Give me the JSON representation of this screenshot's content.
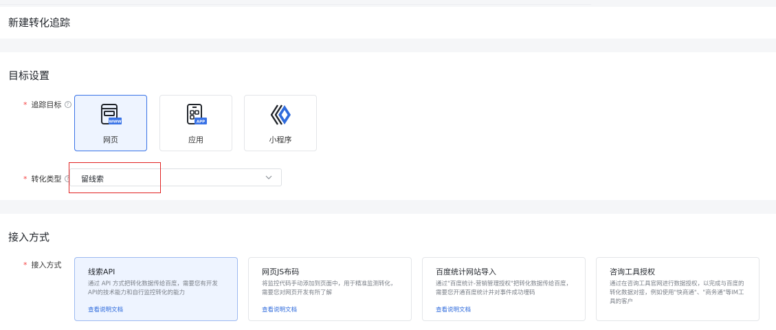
{
  "header": {
    "title": "新建转化追踪"
  },
  "target_section": {
    "title": "目标设置",
    "track_target": {
      "label": "追踪目标",
      "options": [
        {
          "label": "网页",
          "icon": "webpage-www-icon",
          "selected": true
        },
        {
          "label": "应用",
          "icon": "mobile-app-icon",
          "selected": false
        },
        {
          "label": "小程序",
          "icon": "mini-program-icon",
          "selected": false
        }
      ]
    },
    "conversion_type": {
      "label": "转化类型",
      "value": "留线索"
    }
  },
  "access_section": {
    "title": "接入方式",
    "label": "接入方式",
    "methods": [
      {
        "title": "线索API",
        "desc": "通过 API 方式把转化数据传给百度，需要您有开发API的技术能力和自行监控转化的能力",
        "link": "查看说明文档",
        "selected": true
      },
      {
        "title": "网页JS布码",
        "desc": "将监控代码手动添加到页面中，用于精准监测转化，需要您对网页开发有所了解",
        "link": "查看说明文档",
        "selected": false
      },
      {
        "title": "百度统计网站导入",
        "desc": "通过\"百度统计-营销管理授权\"把转化数据传给百度，需要您开通百度统计并对事件成功埋码",
        "link": "查看说明文档",
        "selected": false
      },
      {
        "title": "咨询工具授权",
        "desc": "通过在咨询工具官网进行数据授权，以完成与百度的转化数据对接，例如使用\"快商通\"、\"商务通\"等IM工具的客户",
        "selected": false
      }
    ]
  },
  "colors": {
    "accent": "#3872e6",
    "required": "#f53f3f",
    "link": "#2f6bdc",
    "highlight_box": "#e02020"
  }
}
